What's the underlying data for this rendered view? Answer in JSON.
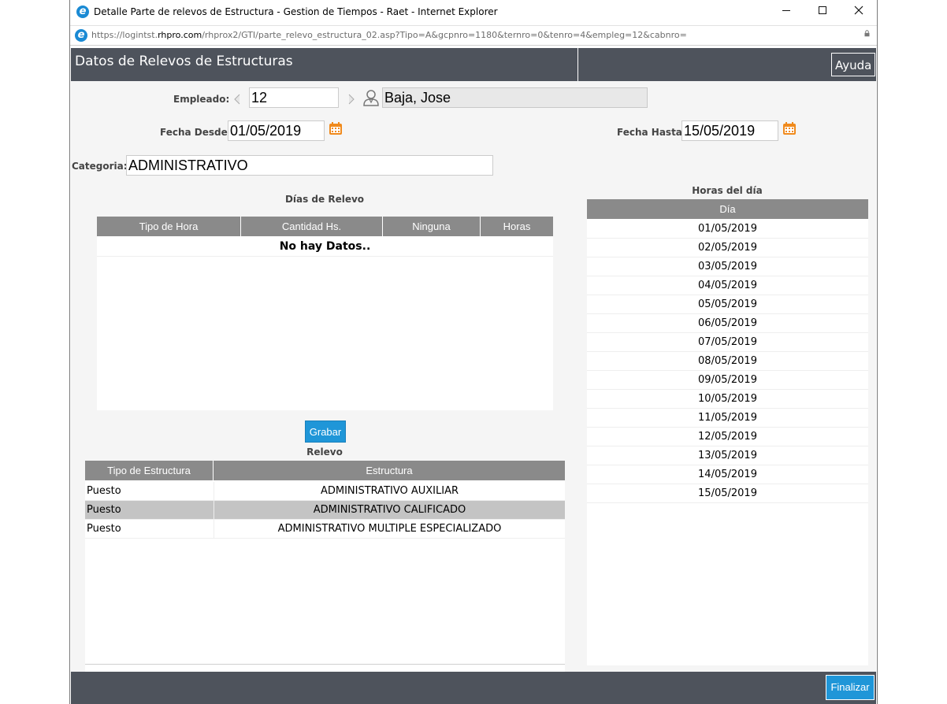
{
  "window": {
    "title": "Detalle Parte de relevos de Estructura - Gestion de Tiempos - Raet - Internet Explorer",
    "url_prefix": "https://logintst.",
    "url_domain": "rhpro.com",
    "url_rest": "/rhprox2/GTI/parte_relevo_estructura_02.asp?Tipo=A&gcpnro=1180&ternro=0&tenro=4&empleg=12&cabnro="
  },
  "header": {
    "title": "Datos de Relevos de Estructuras",
    "help_label": "Ayuda"
  },
  "form": {
    "empleado_label": "Empleado:",
    "empleado_value": "12",
    "empleado_name": "Baja, Jose",
    "fecha_desde_label": "Fecha Desde:",
    "fecha_desde_value": "01/05/2019",
    "fecha_hasta_label": "Fecha Hasta:",
    "fecha_hasta_value": "15/05/2019",
    "categoria_label": "Categoria:",
    "categoria_value": "ADMINISTRATIVO"
  },
  "dias_relevo": {
    "title": "Días de Relevo",
    "columns": [
      "Tipo de Hora",
      "Cantidad Hs.",
      "Ninguna",
      "Horas"
    ],
    "empty_text": "No hay Datos.."
  },
  "grabar_label": "Grabar",
  "relevo": {
    "title": "Relevo",
    "columns": [
      "Tipo de Estructura",
      "Estructura"
    ],
    "rows": [
      {
        "tipo": "Puesto",
        "estructura": "ADMINISTRATIVO AUXILIAR"
      },
      {
        "tipo": "Puesto",
        "estructura": "ADMINISTRATIVO CALIFICADO"
      },
      {
        "tipo": "Puesto",
        "estructura": "ADMINISTRATIVO MULTIPLE ESPECIALIZADO"
      }
    ],
    "selected_row": 1
  },
  "horas_dia": {
    "title": "Horas del día",
    "column": "Día",
    "days": [
      "01/05/2019",
      "02/05/2019",
      "03/05/2019",
      "04/05/2019",
      "05/05/2019",
      "06/05/2019",
      "07/05/2019",
      "08/05/2019",
      "09/05/2019",
      "10/05/2019",
      "11/05/2019",
      "12/05/2019",
      "13/05/2019",
      "14/05/2019",
      "15/05/2019"
    ]
  },
  "footer": {
    "finalizar_label": "Finalizar"
  },
  "colors": {
    "header_bg": "#4e535c",
    "table_header_bg": "#8a8a8a",
    "button_blue": "#1f96d8",
    "selected_row_bg": "#c4c4c4",
    "calendar_orange": "#f08a1c"
  }
}
